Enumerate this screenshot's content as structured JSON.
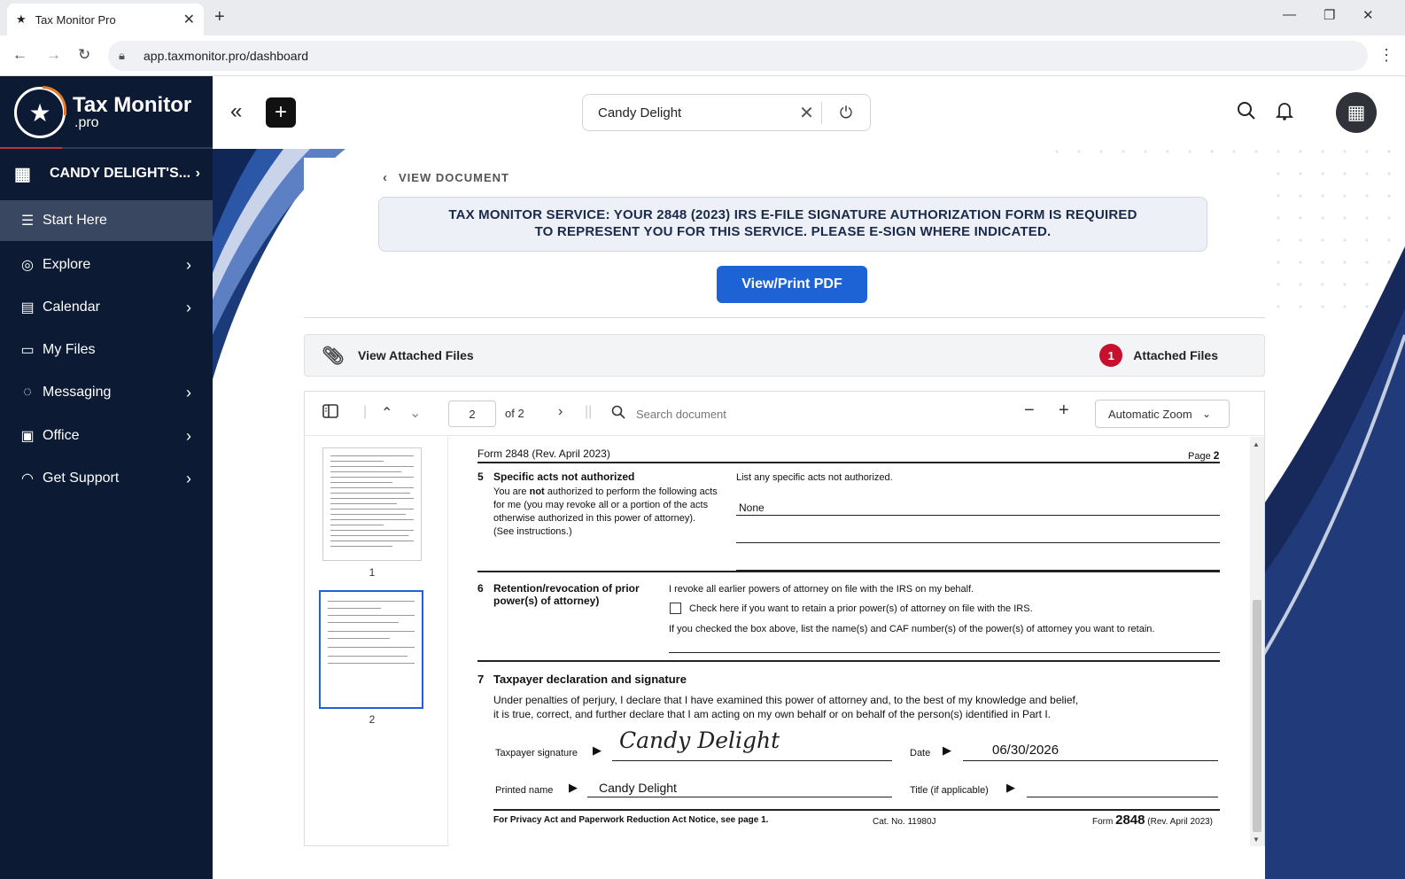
{
  "browser": {
    "tab_title": "Tax Monitor Pro",
    "url": "app.taxmonitor.pro/dashboard"
  },
  "sidebar": {
    "logo_name": "Tax Monitor",
    "logo_suffix": ".pro",
    "client_name": "CANDY DELIGHT'S...",
    "items": [
      {
        "label": "Start Here",
        "icon": "menu-icon"
      },
      {
        "label": "Explore",
        "icon": "compass-icon"
      },
      {
        "label": "Calendar",
        "icon": "calendar-icon"
      },
      {
        "label": "My Files",
        "icon": "folder-icon"
      },
      {
        "label": "Messaging",
        "icon": "chat-icon"
      },
      {
        "label": "Office",
        "icon": "office-icon"
      },
      {
        "label": "Get Support",
        "icon": "headset-icon"
      }
    ]
  },
  "header": {
    "client_selector_value": "Candy Delight"
  },
  "content": {
    "back_label": "VIEW DOCUMENT",
    "notice_line1": "TAX MONITOR SERVICE: YOUR 2848 (2023) IRS E-FILE SIGNATURE AUTHORIZATION FORM IS REQUIRED",
    "notice_line2": "TO REPRESENT YOU FOR THIS SERVICE. PLEASE E-SIGN WHERE INDICATED.",
    "pdf_button": "View/Print PDF",
    "attached_label": "View Attached Files",
    "attached_count": "1",
    "attached_count_label": "Attached Files"
  },
  "viewer": {
    "page_number": "2",
    "page_total": "of 2",
    "search_placeholder": "Search document",
    "zoom": "Automatic Zoom",
    "thumbnails": [
      {
        "label": "1"
      },
      {
        "label": "2"
      }
    ]
  },
  "form": {
    "header_left": "Form 2848 (Rev. April 2023)",
    "header_right_prefix": "Page",
    "header_right_num": "2",
    "s5_num": "5",
    "s5_title": "Specific acts not authorized",
    "s5_body1_a": "You are",
    "s5_body1_b": "not",
    "s5_body1_c": "authorized to perform the following acts",
    "s5_body2": "for me (you may revoke all or a portion of the acts",
    "s5_body3": "otherwise authorized in this power of attorney).",
    "s5_body4": "(See instructions.)",
    "s5_right_label": "List any specific acts not authorized.",
    "s5_value": "None",
    "s6_num": "6",
    "s6_title1": "Retention/revocation of prior",
    "s6_title2": "power(s) of attorney)",
    "s6_line1": "I revoke all earlier powers of attorney on file with the IRS on my behalf.",
    "s6_check": "Check here if you want to retain a prior power(s) of attorney on file with the IRS.",
    "s6_line3": "If you checked the box above, list the name(s) and CAF number(s) of the power(s) of attorney you want to retain.",
    "s7_num": "7",
    "s7_title": "Taxpayer declaration and signature",
    "s7_body1": "Under penalties of perjury, I declare that I have examined this power of attorney and, to the best of my knowledge and belief,",
    "s7_body2": "it is true, correct, and further declare that I am acting on my own behalf or on behalf of the person(s) identified in Part I.",
    "sig_label": "Taxpayer signature",
    "sig_value": "Candy Delight",
    "date_label": "Date",
    "date_value": "06/30/2026",
    "printed_label": "Printed name",
    "printed_value": "Candy Delight",
    "title_label": "Title (if applicable)",
    "footer_left": "For Privacy Act and Paperwork Reduction Act Notice, see page 1.",
    "footer_mid": "Cat. No. 11980J",
    "footer_right_a": "Form",
    "footer_right_b": "2848",
    "footer_right_c": "(Rev. April 2023)"
  },
  "colors": {
    "sidebar_bg": "#0c1a33",
    "accent_blue": "#1e63d6",
    "badge_red": "#c8102e",
    "navy_wave": "#1a2f5e"
  }
}
